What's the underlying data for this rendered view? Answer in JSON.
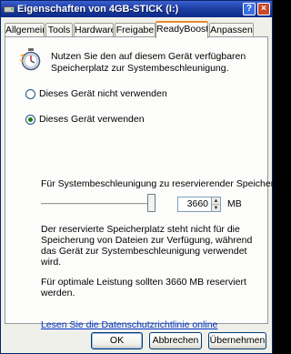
{
  "window": {
    "title": "Eigenschaften von 4GB-STICK (I:)",
    "help_label": "?",
    "close_label": "×"
  },
  "tabs": [
    {
      "label": "Allgemein",
      "active": false
    },
    {
      "label": "Tools",
      "active": false
    },
    {
      "label": "Hardware",
      "active": false
    },
    {
      "label": "Freigabe",
      "active": false
    },
    {
      "label": "ReadyBoost",
      "active": true
    },
    {
      "label": "Anpassen",
      "active": false
    }
  ],
  "readyboost": {
    "icon": "readyboost-stopwatch-icon",
    "description": "Nutzen Sie den auf diesem Gerät verfügbaren Speicherplatz zur Systembeschleunigung.",
    "option_no": "Dieses Gerät nicht verwenden",
    "option_yes": "Dieses Gerät verwenden",
    "selected_option": "yes",
    "reserve_label": "Für Systembeschleunigung zu reservierender Speicher:",
    "slider_fraction": 0.97,
    "reserve_value": "3660",
    "unit": "MB",
    "info_text": "Der reservierte Speicherplatz steht nicht für die Speicherung von Dateien zur Verfügung, während das Gerät zur Systembeschleunigung verwendet wird.",
    "recommendation": "Für optimale Leistung sollten 3660 MB reserviert werden.",
    "privacy_link": "Lesen Sie die Datenschutzrichtlinie online"
  },
  "buttons": {
    "ok": "OK",
    "cancel": "Abbrechen",
    "apply": "Übernehmen"
  },
  "colors": {
    "titlebar": "#1f3fa3",
    "active_tab_accent": "#e68b2c",
    "link": "#0033cc",
    "radio_dot": "#1a7a1a"
  }
}
